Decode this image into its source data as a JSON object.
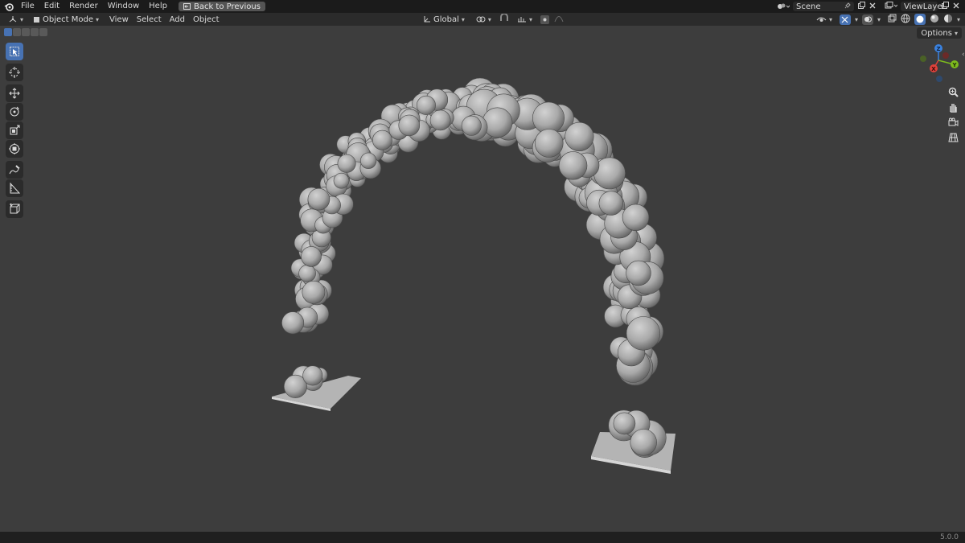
{
  "menubar": {
    "items": [
      "File",
      "Edit",
      "Render",
      "Window",
      "Help"
    ],
    "back_button": "Back to Previous",
    "scene": "Scene",
    "view_layer": "ViewLayer"
  },
  "header": {
    "mode": "Object Mode",
    "menus": [
      "View",
      "Select",
      "Add",
      "Object"
    ],
    "transform_orientation": "Global"
  },
  "options_label": "Options",
  "gizmo": {
    "x": "X",
    "y": "Y",
    "z": "Z"
  },
  "status": {
    "version": "5.0.0"
  },
  "colors": {
    "accent": "#4772b3",
    "axis_x": "#e0413a",
    "axis_y": "#7dbb1d",
    "axis_z": "#3a82e0",
    "viewport": "#3d3d3d"
  }
}
